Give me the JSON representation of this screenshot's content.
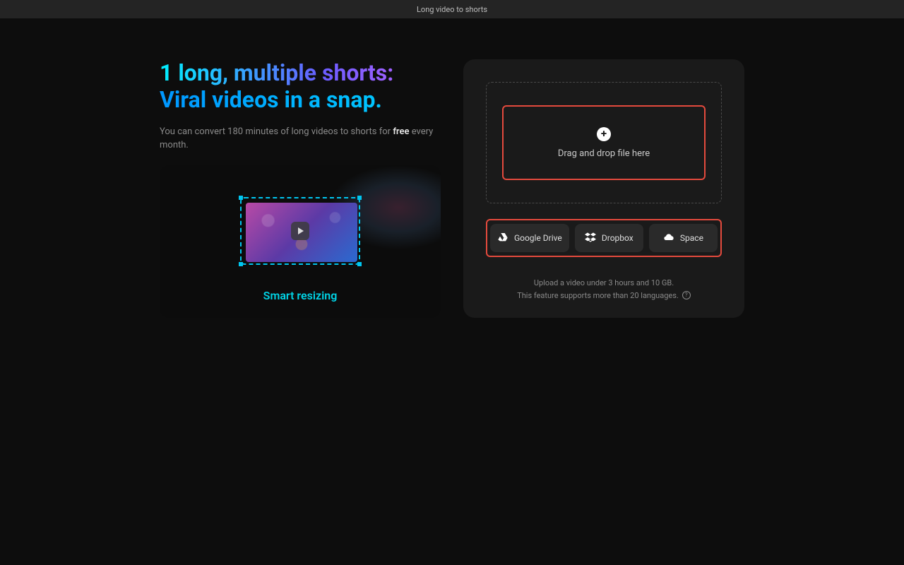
{
  "topbar": {
    "title": "Long video to shorts"
  },
  "hero": {
    "headline_part1": "1 long, multiple shorts: ",
    "headline_part2": "Viral videos in a snap.",
    "sub_before": "You can convert 180 minutes of long videos to shorts for ",
    "sub_bold": "free",
    "sub_after": " every month."
  },
  "preview": {
    "label": "Smart resizing"
  },
  "upload": {
    "drop_label": "Drag and drop file here",
    "providers": {
      "google_drive": "Google Drive",
      "dropbox": "Dropbox",
      "space": "Space"
    },
    "footer_line1": "Upload a video under 3 hours and 10 GB.",
    "footer_line2": "This feature supports more than 20 languages."
  }
}
